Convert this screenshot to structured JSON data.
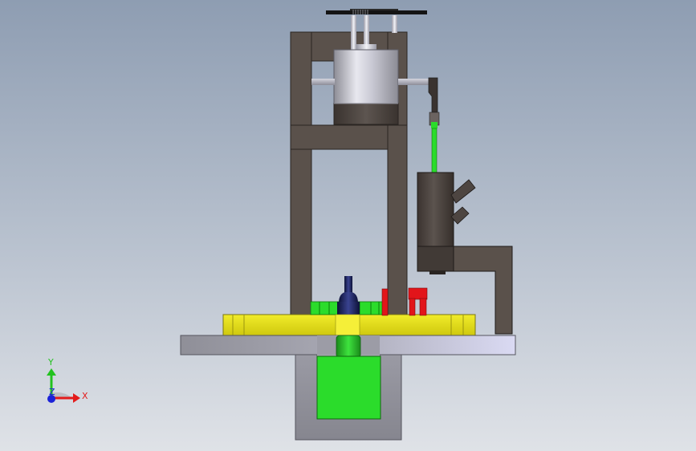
{
  "triad": {
    "x_label": "X",
    "y_label": "Y",
    "z_label": "Z",
    "x_color": "#e31b1b",
    "y_color": "#22c21e",
    "z_color": "#1b22d8"
  },
  "colors": {
    "frame": "#5a514b",
    "frame_dark": "#3c3531",
    "base": "#8a8a93",
    "steel_light": "#e4e4ee",
    "steel_mid": "#a9a9b7",
    "yellow": "#e6e01b",
    "green": "#2bdc2b",
    "red": "#e2151a",
    "navy": "#1b2150"
  }
}
